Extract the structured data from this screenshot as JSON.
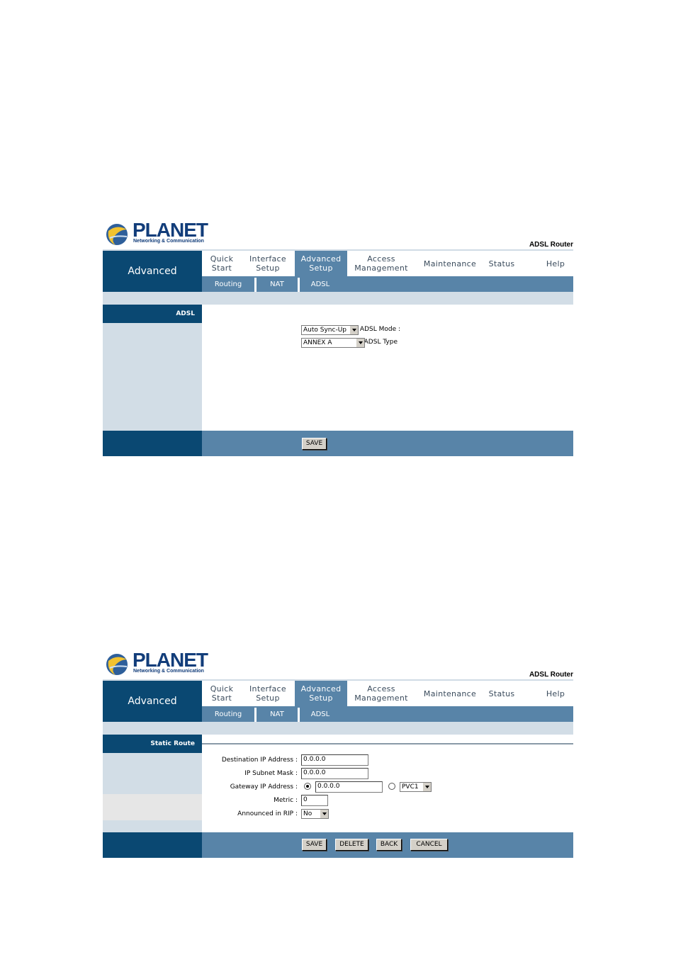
{
  "brand": {
    "logo_word": "PLANET",
    "logo_tagline": "Networking & Communication",
    "product": "ADSL Router"
  },
  "side_title": "Advanced",
  "menu": [
    {
      "line1": "Quick",
      "line2": "Start"
    },
    {
      "line1": "Interface",
      "line2": "Setup"
    },
    {
      "line1": "Advanced",
      "line2": "Setup"
    },
    {
      "line1": "Access",
      "line2": "Management"
    },
    {
      "line1": "Maintenance",
      "line2": ""
    },
    {
      "line1": "Status",
      "line2": ""
    },
    {
      "line1": "Help",
      "line2": ""
    }
  ],
  "submenu": [
    "Routing",
    "NAT",
    "ADSL"
  ],
  "screen1": {
    "section": "ADSL",
    "adsl_mode": {
      "label": "ADSL Mode :",
      "value": "Auto Sync-Up"
    },
    "adsl_type": {
      "label": "ADSL Type",
      "value": "ANNEX A"
    },
    "save": "SAVE"
  },
  "screen2": {
    "section": "Static Route",
    "dest_ip": {
      "label": "Destination IP Address :",
      "value": "0.0.0.0"
    },
    "subnet": {
      "label": "IP Subnet Mask :",
      "value": "0.0.0.0"
    },
    "gateway": {
      "label": "Gateway IP Address :",
      "value": "0.0.0.0",
      "pvc": "PVC1"
    },
    "metric": {
      "label": "Metric :",
      "value": "0"
    },
    "rip": {
      "label": "Announced in RIP :",
      "value": "No"
    },
    "buttons": {
      "save": "SAVE",
      "delete": "DELETE",
      "back": "BACK",
      "cancel": "CANCEL"
    }
  },
  "colors": {
    "dark_blue": "#0a4872",
    "mid_blue": "#5884a8",
    "light_blue": "#d2dde6"
  }
}
